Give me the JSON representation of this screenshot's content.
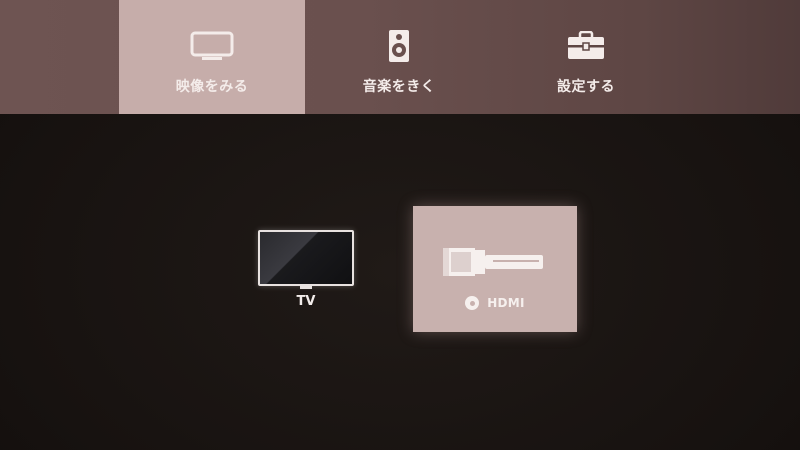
{
  "top_menu": {
    "items": [
      {
        "label": "映像をみる",
        "icon": "tv-icon",
        "selected": true
      },
      {
        "label": "音楽をきく",
        "icon": "speaker-icon",
        "selected": false
      },
      {
        "label": "設定する",
        "icon": "toolbox-icon",
        "selected": false
      }
    ]
  },
  "inputs": {
    "items": [
      {
        "label": "TV",
        "icon": "tv-screen-icon",
        "selected": false
      },
      {
        "label": "HDMI",
        "icon": "hdmi-plug-icon",
        "selected": true
      }
    ]
  },
  "colors": {
    "menu_bar": "#6e5452",
    "menu_selected": "#c6adaa",
    "background": "#181310",
    "tile_selected": "#c8b1ae",
    "text": "#f4ecea"
  }
}
